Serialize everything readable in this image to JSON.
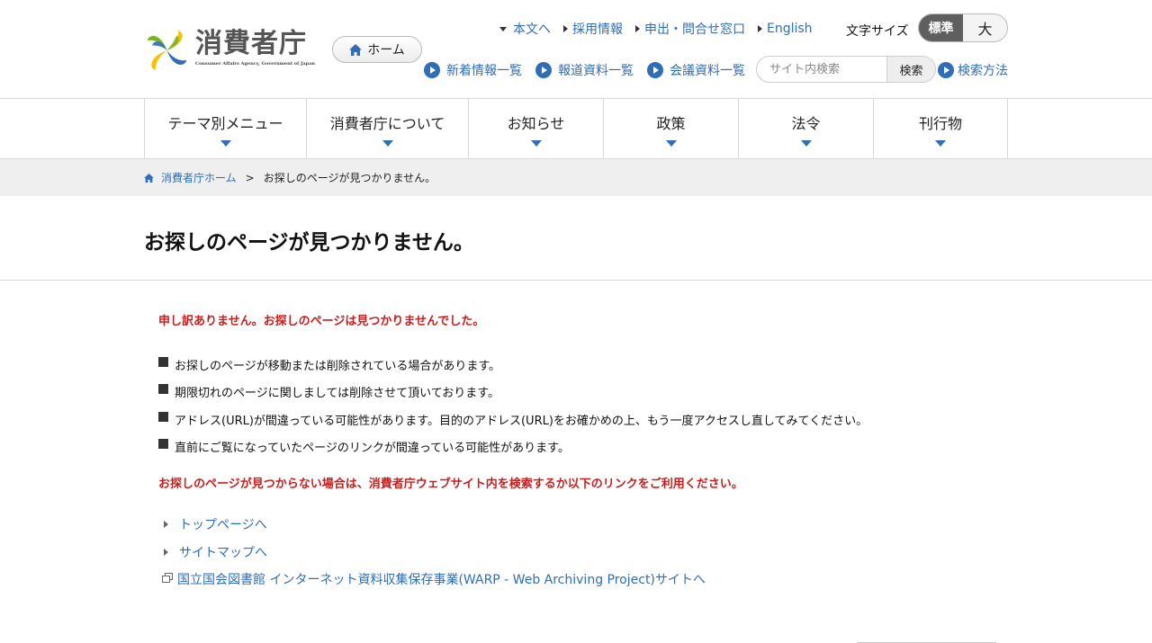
{
  "colors": {
    "link": "#2f6db5",
    "alert": "#cc1d1d",
    "toggle_active": "#5f5f5f",
    "logo_green": "#7ab51d",
    "logo_yellow": "#f5c400",
    "logo_blue": "#2f6db5"
  },
  "header": {
    "logo_jp": "消費者庁",
    "logo_en": "Consumer Affairs Agency, Government of Japan",
    "home_button": "ホーム",
    "top_links": {
      "main_content": "本文へ",
      "recruit": "採用情報",
      "contact": "申出・問合せ窓口",
      "english": "English"
    },
    "font_size": {
      "label": "文字サイズ",
      "standard": "標準",
      "large": "大"
    },
    "sub_links": {
      "news": "新着情報一覧",
      "press": "報道資料一覧",
      "meetings": "会議資料一覧"
    },
    "search": {
      "placeholder": "サイト内検索",
      "button": "検索",
      "help": "検索方法"
    }
  },
  "gnav": {
    "theme": "テーマ別メニュー",
    "about": "消費者庁について",
    "notices": "お知らせ",
    "policy": "政策",
    "laws": "法令",
    "publications": "刊行物"
  },
  "breadcrumb": {
    "home": "消費者庁ホーム",
    "separator": ">",
    "current": "お探しのページが見つかりません。"
  },
  "main": {
    "title": "お探しのページが見つかりません。",
    "apology": "申し訳ありません。お探しのページは見つかりませんでした。",
    "reasons": [
      "お探しのページが移動または削除されている場合があります。",
      "期限切れのページに関しましては削除させて頂いております。",
      "アドレス(URL)が間違っている可能性があります。目的のアドレス(URL)をお確かめの上、もう一度アクセスし直してみてください。",
      "直前にご覧になっていたページのリンクが間違っている可能性があります。"
    ],
    "guidance": "お探しのページが見つからない場合は、消費者庁ウェブサイト内を検索するか以下のリンクをご利用ください。",
    "links": {
      "top": "トップページへ",
      "sitemap": "サイトマップへ",
      "warp": "国立国会図書館 インターネット資料収集保存事業(WARP - Web Archiving Project)サイトへ"
    }
  }
}
